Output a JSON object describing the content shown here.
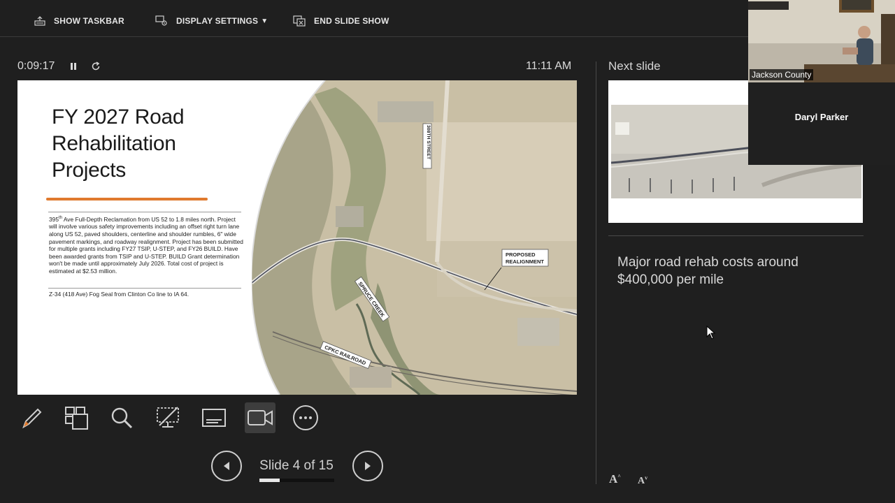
{
  "toolbar": {
    "show_taskbar": "SHOW TASKBAR",
    "display_settings": "DISPLAY SETTINGS",
    "end_slide_show": "END SLIDE SHOW"
  },
  "timer": "0:09:17",
  "clock": "11:11 AM",
  "current_slide": {
    "title_lines": [
      "FY 2027 Road",
      "Rehabilitation",
      "Projects"
    ],
    "body_prefix": "395",
    "body_sup": "th",
    "body_text": " Ave Full-Depth Reclamation from US 52 to 1.8 miles north. Project will involve various safety improvements including an offset right turn lane along US 52, paved shoulders, centerline and shoulder rumbles, 6\" wide pavement markings, and roadway realignment. Project has been submitted for multiple grants including FY27 TSIP, U-STEP, and FY26 BUILD. Have been awarded grants from TSIP and U-STEP. BUILD Grant determination won't be made until approximately July 2026. Total cost of project is estimated at $2.53 million.",
    "body_text_2": "Z-34 (418 Ave) Fog Seal from Clinton Co line to IA 64.",
    "map_labels": {
      "street": "308TH STREET",
      "realignment_1": "PROPOSED",
      "realignment_2": "REALIGNMENT",
      "creek": "SPRUCE CREEK",
      "railroad": "CPKC RAILROAD"
    }
  },
  "next_slide_label": "Next slide",
  "notes": "Major road rehab costs around $400,000 per mile",
  "video": {
    "county_label": "Jackson County",
    "participant_name": "Daryl Parker"
  },
  "navigation": {
    "slide_counter": "Slide 4 of 15",
    "progress": 0.267
  }
}
